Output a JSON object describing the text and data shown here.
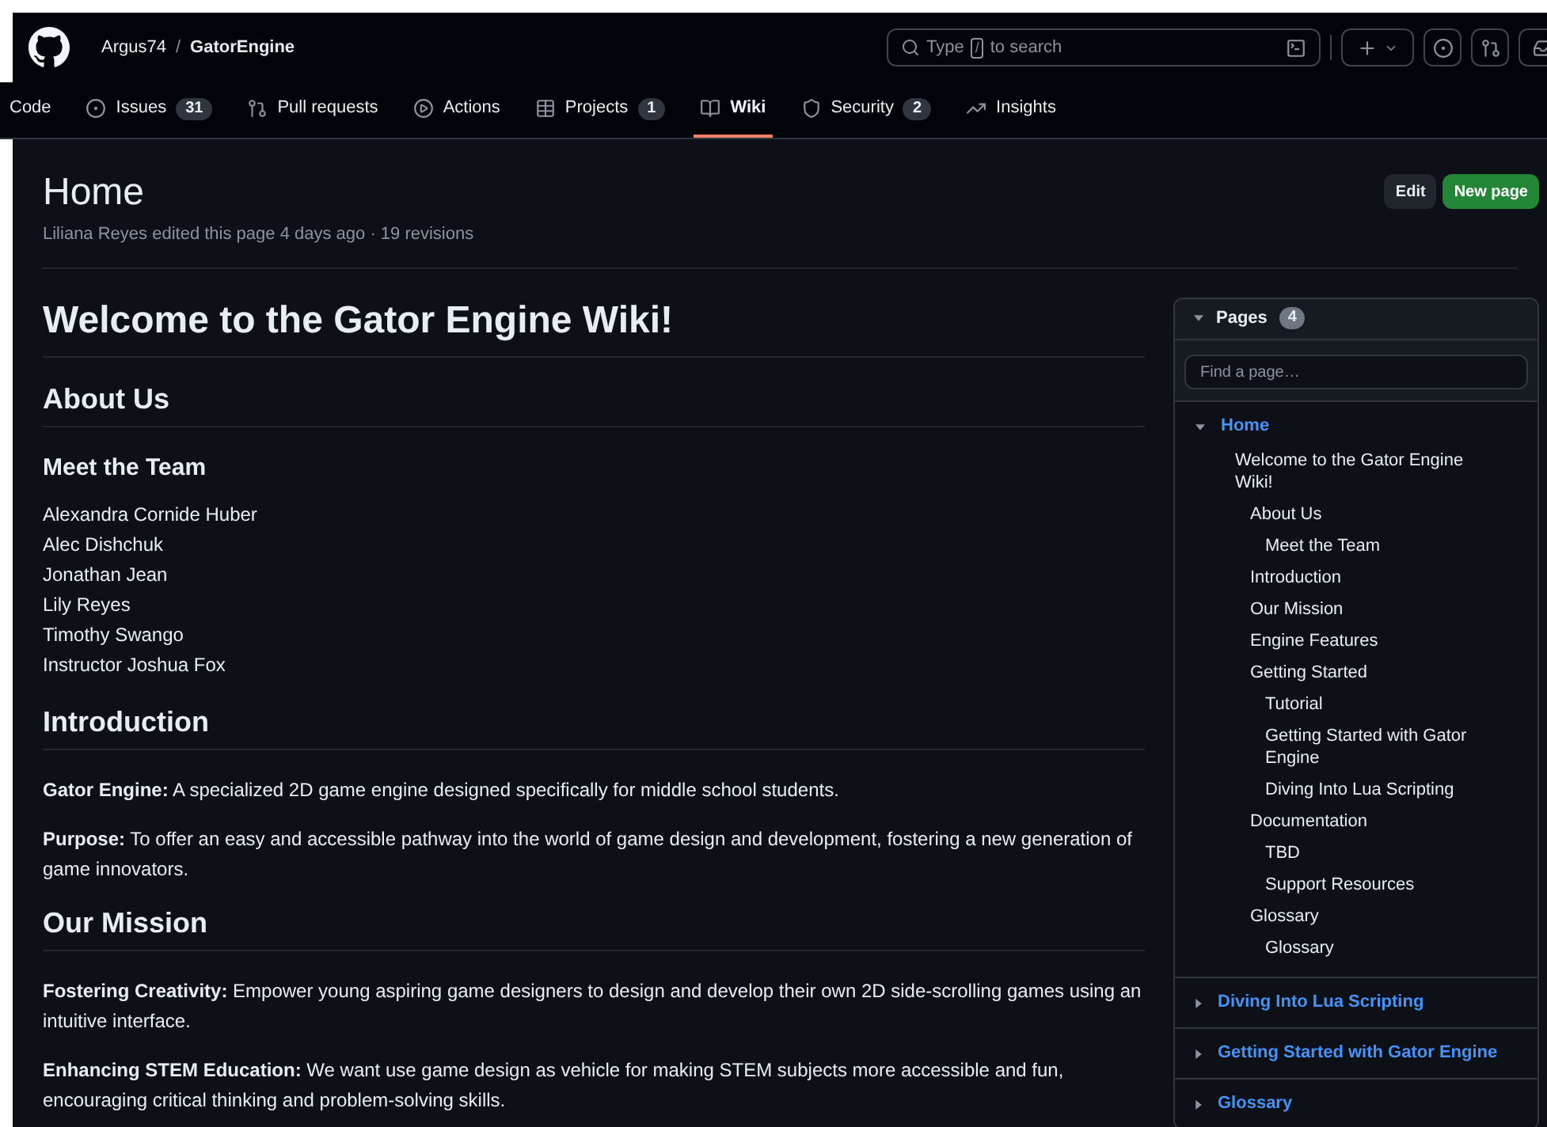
{
  "header": {
    "owner": "Argus74",
    "separator": "/",
    "repo": "GatorEngine",
    "search": {
      "placeholder_before": "Type",
      "key": "/",
      "placeholder_after": "to search"
    }
  },
  "nav": [
    {
      "label": "Code",
      "selected": false
    },
    {
      "label": "Issues",
      "count": "31",
      "selected": false
    },
    {
      "label": "Pull requests",
      "selected": false
    },
    {
      "label": "Actions",
      "selected": false
    },
    {
      "label": "Projects",
      "count": "1",
      "selected": false
    },
    {
      "label": "Wiki",
      "selected": true
    },
    {
      "label": "Security",
      "count": "2",
      "selected": false
    },
    {
      "label": "Insights",
      "selected": false
    }
  ],
  "page": {
    "title": "Home",
    "meta": "Liliana Reyes edited this page 4 days ago · 19 revisions",
    "buttons": [
      {
        "label": "Edit",
        "kind": "secondary"
      },
      {
        "label": "New page",
        "kind": "primary"
      }
    ]
  },
  "content": [
    {
      "kind": "h1",
      "text": "Welcome to the Gator Engine Wiki!"
    },
    {
      "kind": "h2",
      "text": "About Us"
    },
    {
      "kind": "h3",
      "text": "Meet the Team"
    },
    {
      "kind": "lines",
      "lines": [
        "Alexandra Cornide Huber",
        "Alec Dishchuk",
        "Jonathan Jean",
        "Lily Reyes",
        "Timothy Swango",
        "Instructor Joshua Fox"
      ]
    },
    {
      "kind": "h2",
      "text": "Introduction"
    },
    {
      "kind": "p",
      "text": "**Gator Engine:** A specialized 2D game engine designed specifically for middle school students."
    },
    {
      "kind": "p",
      "text": "**Purpose:** To offer an easy and accessible pathway into the world of game design and development, fostering a new generation of game innovators."
    },
    {
      "kind": "h2",
      "text": "Our Mission"
    },
    {
      "kind": "p",
      "text": "**Fostering Creativity:** Empower young aspiring game designers to design and develop their own 2D side-scrolling games using an intuitive interface."
    },
    {
      "kind": "p",
      "text": "**Enhancing STEM Education:** We want use game design as vehicle for making STEM subjects more accessible and fun, encouraging critical thinking and problem-solving skills."
    }
  ],
  "sidebar": {
    "title": "Pages",
    "count": "4",
    "search": {
      "placeholder": "Find a page…"
    },
    "pages": [
      {
        "title": "Home",
        "expanded": true,
        "outline": [
          {
            "text": "Welcome to the Gator Engine Wiki!",
            "children": [
              {
                "text": "About Us",
                "children": [
                  {
                    "text": "Meet the Team"
                  }
                ]
              },
              {
                "text": "Introduction"
              },
              {
                "text": "Our Mission"
              },
              {
                "text": "Engine Features"
              },
              {
                "text": "Getting Started",
                "children": [
                  {
                    "text": "Tutorial"
                  },
                  {
                    "text": "Getting Started with Gator Engine"
                  },
                  {
                    "text": "Diving Into Lua Scripting"
                  }
                ]
              },
              {
                "text": "Documentation",
                "children": [
                  {
                    "text": "TBD"
                  },
                  {
                    "text": "Support Resources"
                  }
                ]
              },
              {
                "text": "Glossary",
                "children": [
                  {
                    "text": "Glossary"
                  }
                ]
              }
            ]
          }
        ]
      },
      {
        "title": "Diving Into Lua Scripting",
        "expanded": false
      },
      {
        "title": "Getting Started with Gator Engine",
        "expanded": false
      },
      {
        "title": "Glossary",
        "expanded": false
      }
    ]
  }
}
